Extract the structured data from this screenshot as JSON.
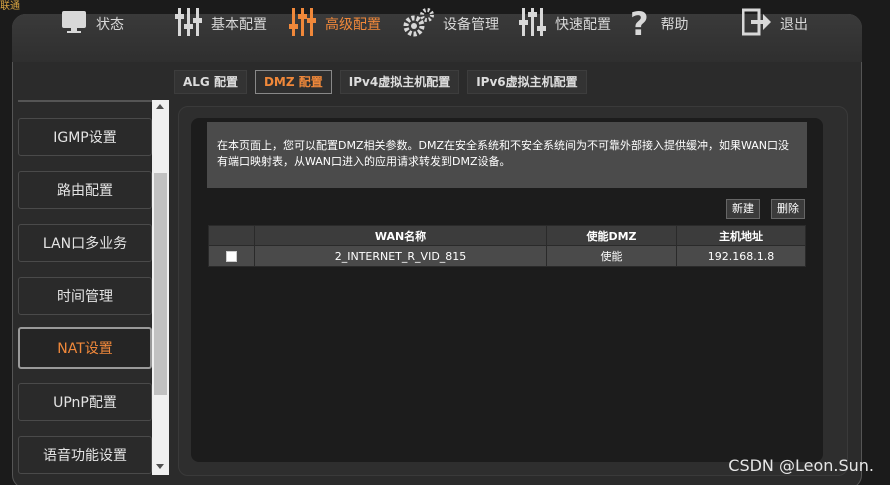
{
  "corner_text": "联通",
  "nav": {
    "items": [
      {
        "label": "状态",
        "icon": "monitor-icon"
      },
      {
        "label": "基本配置",
        "icon": "sliders-icon"
      },
      {
        "label": "高级配置",
        "icon": "sliders-advanced-icon"
      },
      {
        "label": "设备管理",
        "icon": "gears-icon"
      },
      {
        "label": "快速配置",
        "icon": "sliders-quick-icon"
      },
      {
        "label": "帮助",
        "icon": "question-icon"
      },
      {
        "label": "退出",
        "icon": "logout-icon"
      }
    ],
    "active": "高级配置"
  },
  "subtabs": [
    "ALG 配置",
    "DMZ 配置",
    "IPv4虚拟主机配置",
    "IPv6虚拟主机配置"
  ],
  "sidebar": {
    "items": [
      "IGMP设置",
      "路由配置",
      "LAN口多业务",
      "时间管理",
      "NAT设置",
      "UPnP配置",
      "语音功能设置"
    ],
    "active": "NAT设置"
  },
  "info": "在本页面上，您可以配置DMZ相关参数。DMZ在安全系统和不安全系统间为不可靠外部接入提供缓冲，如果WAN口没有端口映射表，从WAN口进入的应用请求转发到DMZ设备。",
  "buttons": {
    "new": "新建",
    "delete": "删除"
  },
  "table": {
    "headers": [
      "",
      "WAN名称",
      "使能DMZ",
      "主机地址"
    ],
    "rows": [
      {
        "wan": "2_INTERNET_R_VID_815",
        "enable": "使能",
        "host": "192.168.1.8"
      }
    ]
  },
  "watermark": "CSDN @Leon.Sun.",
  "colors": {
    "accent": "#f0883a",
    "background": "#1b1b1b"
  }
}
